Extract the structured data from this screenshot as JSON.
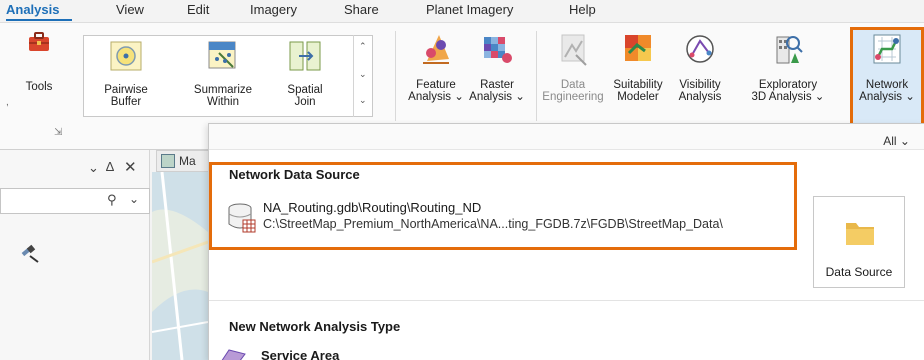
{
  "tabs": [
    {
      "label": "Analysis",
      "active": true
    },
    {
      "label": "View"
    },
    {
      "label": "Edit"
    },
    {
      "label": "Imagery"
    },
    {
      "label": "Share"
    },
    {
      "label": "Planet Imagery"
    },
    {
      "label": "Help"
    }
  ],
  "ribbon": {
    "tools_label": "Tools",
    "gallery": [
      {
        "line1": "Pairwise",
        "line2": "Buffer"
      },
      {
        "line1": "Summarize",
        "line2": "Within"
      },
      {
        "line1": "Spatial",
        "line2": "Join"
      }
    ],
    "buttons": [
      {
        "line1": "Feature",
        "line2": "Analysis ⌄"
      },
      {
        "line1": "Raster",
        "line2": "Analysis ⌄"
      },
      {
        "line1": "Data",
        "line2": "Engineering"
      },
      {
        "line1": "Suitability",
        "line2": "Modeler"
      },
      {
        "line1": "Visibility",
        "line2": "Analysis"
      },
      {
        "line1": "Exploratory",
        "line2": "3D Analysis ⌄"
      },
      {
        "line1": "Network",
        "line2": "Analysis ⌄"
      }
    ]
  },
  "colors": {
    "accent": "#1d6fb8",
    "highlight_border": "#e46c0a",
    "selected_bg": "#d9e9f7"
  },
  "dropdown": {
    "filter_label": "All ⌄",
    "network_data_source_title": "Network Data Source",
    "data_source_name": "NA_Routing.gdb\\Routing\\Routing_ND",
    "data_source_path": "C:\\StreetMap_Premium_NorthAmerica\\NA...ting_FGDB.7z\\FGDB\\StreetMap_Data\\",
    "data_source_button": "Data Source",
    "new_analysis_title": "New Network Analysis Type",
    "service_area_label": "Service Area"
  },
  "left_panel": {
    "map_tab_label": "Ma"
  }
}
